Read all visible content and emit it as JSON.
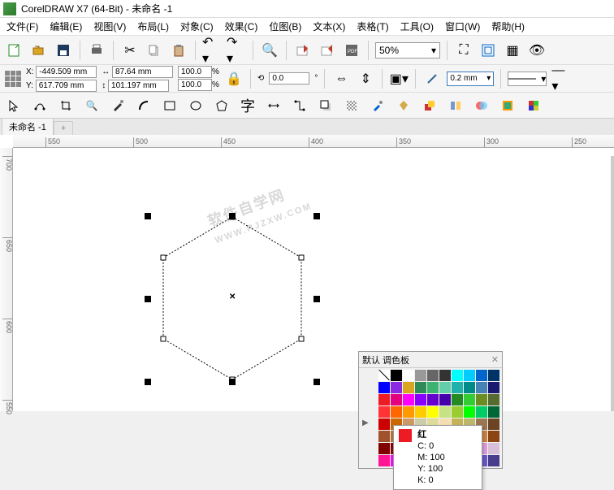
{
  "title": "CorelDRAW X7 (64-Bit) - 未命名 -1",
  "menu": [
    "文件(F)",
    "编辑(E)",
    "视图(V)",
    "布局(L)",
    "对象(C)",
    "效果(C)",
    "位图(B)",
    "文本(X)",
    "表格(T)",
    "工具(O)",
    "窗口(W)",
    "帮助(H)"
  ],
  "zoom": "50%",
  "props": {
    "x": "-449.509 mm",
    "y": "617.709 mm",
    "w": "87.64 mm",
    "h": "101.197 mm",
    "sx": "100.0",
    "sy": "100.0",
    "rotation": "0.0",
    "outline": "0.2 mm"
  },
  "tab_name": "未命名 -1",
  "ruler_h": [
    "550",
    "500",
    "450",
    "400",
    "350",
    "300",
    "250"
  ],
  "ruler_v": [
    "700",
    "650",
    "600",
    "550"
  ],
  "palette": {
    "title": "默认 调色板",
    "tooltip": {
      "name": "红",
      "c": "C: 0",
      "m": "M: 100",
      "y": "Y: 100",
      "k": "K: 0",
      "color": "#ed1c24"
    },
    "colors": [
      "none",
      "#000",
      "#fff",
      "#999",
      "#666",
      "#333",
      "#0ff",
      "#0cf",
      "#06c",
      "#036",
      "#00f",
      "#8a2be2",
      "#daa520",
      "#2e8b57",
      "#3cb371",
      "#66cdaa",
      "#20b2aa",
      "#008b8b",
      "#4682b4",
      "#191970",
      "#ed1c24",
      "#e4007f",
      "#ff00ff",
      "#8800ff",
      "#6600cc",
      "#4400aa",
      "#228b22",
      "#32cd32",
      "#6b8e23",
      "#556b2f",
      "#ff3333",
      "#ff6600",
      "#ff9900",
      "#ffcc00",
      "#ffff00",
      "#c5e384",
      "#9acd32",
      "#00ff00",
      "#00cc66",
      "#006633",
      "#cc0000",
      "#cc6600",
      "#cc9966",
      "#ccccaa",
      "#dddd99",
      "#f5deb3",
      "#c5b358",
      "#bdb76b",
      "#9b7653",
      "#6b4423",
      "#a0522d",
      "#b87333",
      "#d2b48c",
      "#f4a460",
      "#ffe4c4",
      "#faf0e6",
      "#eedd82",
      "#daa520",
      "#cd853f",
      "#8b4513",
      "#800000",
      "#8b0000",
      "#a52a2a",
      "#b22222",
      "#dc143c",
      "#c71585",
      "#db7093",
      "#ff69b4",
      "#dda0dd",
      "#d8bfd8",
      "#ff1493",
      "#ff00ff",
      "#ee82ee",
      "#da70d6",
      "#ba55d3",
      "#9370db",
      "#8a2be2",
      "#9400d3",
      "#6a5acd",
      "#483d8b"
    ]
  }
}
